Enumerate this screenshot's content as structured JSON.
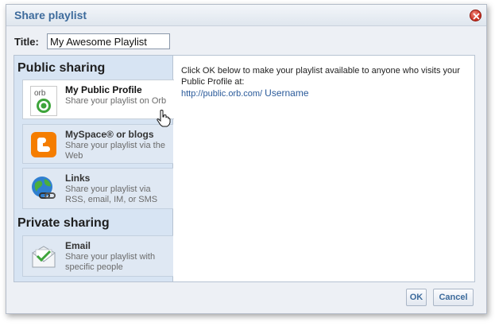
{
  "dialog": {
    "title": "Share playlist",
    "close_icon": "close-x-icon"
  },
  "title_field": {
    "label": "Title:",
    "value": "My Awesome Playlist"
  },
  "sidebar": {
    "public_heading": "Public sharing",
    "private_heading": "Private sharing",
    "options": [
      {
        "title": "My Public Profile",
        "desc": "Share your playlist on Orb",
        "icon": "orb-logo-icon",
        "selected": true
      },
      {
        "title": "MySpace® or blogs",
        "desc": "Share your playlist via the Web",
        "icon": "blogger-icon",
        "selected": false
      },
      {
        "title": "Links",
        "desc": "Share your playlist via RSS, email, IM, or SMS",
        "icon": "globe-link-icon",
        "selected": false
      },
      {
        "title": "Email",
        "desc": "Share your playlist with specific people",
        "icon": "envelope-icon",
        "selected": false
      }
    ]
  },
  "content": {
    "message": "Click OK below to make your playlist available to anyone who visits your Public Profile at:",
    "url_base": "http://public.orb.com/",
    "url_user": "Username"
  },
  "buttons": {
    "ok": "OK",
    "cancel": "Cancel"
  },
  "colors": {
    "accent": "#3d6b9c",
    "sidebar_bg": "#d7e4f3",
    "dialog_bg": "#edf0f5"
  }
}
